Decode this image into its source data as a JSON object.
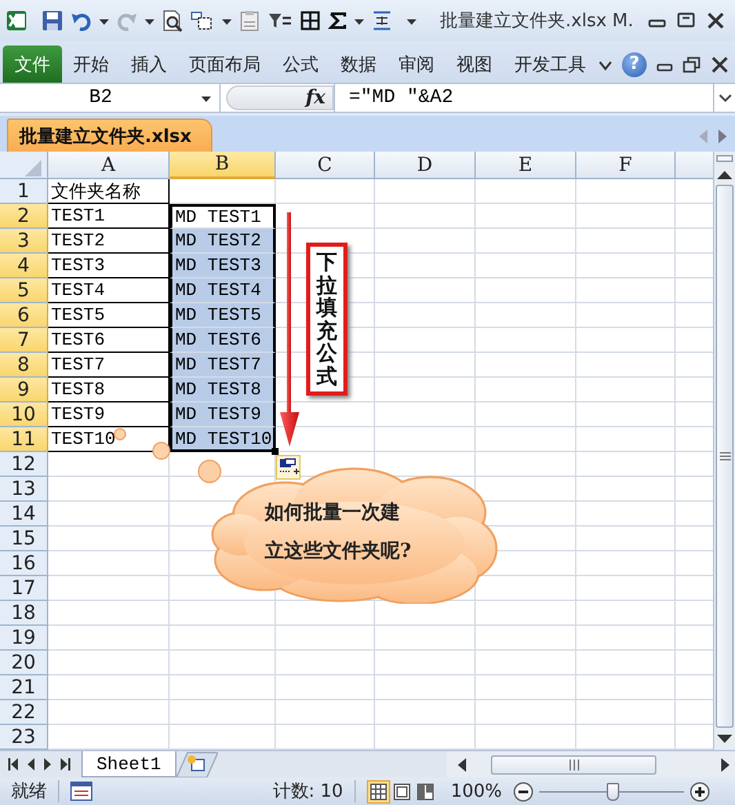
{
  "title_bar": {
    "title": "批量建立文件夹.xlsx M."
  },
  "ribbon": {
    "tabs": [
      {
        "label": "文件",
        "kind": "file"
      },
      {
        "label": "开始",
        "kind": "tab"
      },
      {
        "label": "插入",
        "kind": "tab"
      },
      {
        "label": "页面布局",
        "kind": "tab"
      },
      {
        "label": "公式",
        "kind": "tab"
      },
      {
        "label": "数据",
        "kind": "tab"
      },
      {
        "label": "审阅",
        "kind": "tab"
      },
      {
        "label": "视图",
        "kind": "tab"
      },
      {
        "label": "开发工具",
        "kind": "tab"
      }
    ],
    "help": "?"
  },
  "formula_bar": {
    "name_box": "B2",
    "function_label": "fx",
    "formula": "=\"MD \"&A2"
  },
  "workbook_tab": {
    "label": "批量建立文件夹.xlsx"
  },
  "columns": [
    {
      "label": "A",
      "selected": false
    },
    {
      "label": "B",
      "selected": true
    },
    {
      "label": "C",
      "selected": false
    },
    {
      "label": "D",
      "selected": false
    },
    {
      "label": "E",
      "selected": false
    },
    {
      "label": "F",
      "selected": false
    }
  ],
  "rows": [
    {
      "label": "1",
      "selected": false,
      "cells": [
        {
          "text": "文件夹名称",
          "selected": false
        }
      ]
    },
    {
      "label": "2",
      "selected": true,
      "cells": [
        {
          "text": "TEST1",
          "selected": false
        },
        {
          "text": "MD TEST1",
          "selected": true,
          "active": true
        }
      ]
    },
    {
      "label": "3",
      "selected": true,
      "cells": [
        {
          "text": "TEST2",
          "selected": false
        },
        {
          "text": "MD TEST2",
          "selected": true,
          "active": false
        }
      ]
    },
    {
      "label": "4",
      "selected": true,
      "cells": [
        {
          "text": "TEST3",
          "selected": false
        },
        {
          "text": "MD TEST3",
          "selected": true,
          "active": false
        }
      ]
    },
    {
      "label": "5",
      "selected": true,
      "cells": [
        {
          "text": "TEST4",
          "selected": false
        },
        {
          "text": "MD TEST4",
          "selected": true,
          "active": false
        }
      ]
    },
    {
      "label": "6",
      "selected": true,
      "cells": [
        {
          "text": "TEST5",
          "selected": false
        },
        {
          "text": "MD TEST5",
          "selected": true,
          "active": false
        }
      ]
    },
    {
      "label": "7",
      "selected": true,
      "cells": [
        {
          "text": "TEST6",
          "selected": false
        },
        {
          "text": "MD TEST6",
          "selected": true,
          "active": false
        }
      ]
    },
    {
      "label": "8",
      "selected": true,
      "cells": [
        {
          "text": "TEST7",
          "selected": false
        },
        {
          "text": "MD TEST7",
          "selected": true,
          "active": false
        }
      ]
    },
    {
      "label": "9",
      "selected": true,
      "cells": [
        {
          "text": "TEST8",
          "selected": false
        },
        {
          "text": "MD TEST8",
          "selected": true,
          "active": false
        }
      ]
    },
    {
      "label": "10",
      "selected": true,
      "cells": [
        {
          "text": "TEST9",
          "selected": false
        },
        {
          "text": "MD TEST9",
          "selected": true,
          "active": false
        }
      ]
    },
    {
      "label": "11",
      "selected": true,
      "cells": [
        {
          "text": "TEST10",
          "selected": false
        },
        {
          "text": "MD TEST10",
          "selected": true,
          "active": false
        }
      ]
    },
    {
      "label": "12",
      "selected": false
    },
    {
      "label": "13",
      "selected": false
    },
    {
      "label": "14",
      "selected": false
    },
    {
      "label": "15",
      "selected": false
    },
    {
      "label": "16",
      "selected": false
    },
    {
      "label": "17",
      "selected": false
    },
    {
      "label": "18",
      "selected": false
    },
    {
      "label": "19",
      "selected": false
    },
    {
      "label": "20",
      "selected": false
    },
    {
      "label": "21",
      "selected": false
    },
    {
      "label": "22",
      "selected": false
    },
    {
      "label": "23",
      "selected": false
    }
  ],
  "annotations": {
    "fill_note": "下拉填充公式",
    "callout": "如何批量一次建立这些文件夹呢?"
  },
  "sheet_tabs": [
    {
      "label": "Sheet1",
      "selected": true
    }
  ],
  "status_bar": {
    "status": "就绪",
    "count": "计数: 10",
    "views": [
      {
        "kind": "normal",
        "selected": true
      },
      {
        "kind": "page_layout",
        "selected": false
      },
      {
        "kind": "page_break",
        "selected": false
      }
    ],
    "zoom": "100%",
    "level": 0.5
  }
}
